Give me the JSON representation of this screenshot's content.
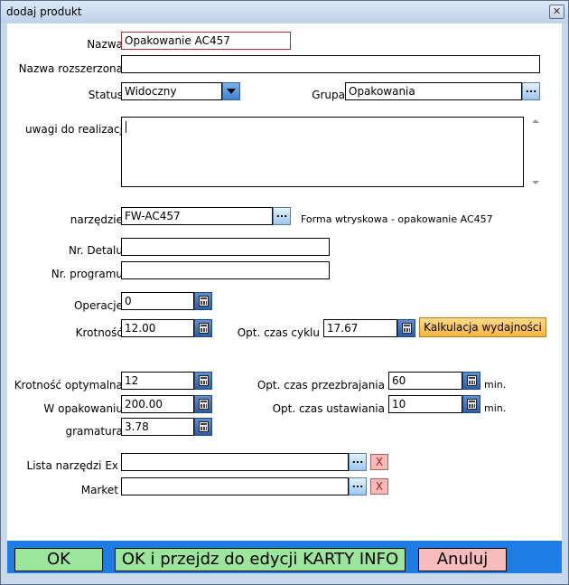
{
  "window": {
    "title": "dodaj produkt",
    "close_label": "✕"
  },
  "form": {
    "nazwa": {
      "label": "Nazwa",
      "value": "Opakowanie AC457"
    },
    "nazwa_rozszerzona": {
      "label": "Nazwa rozszerzona",
      "value": ""
    },
    "status": {
      "label": "Status",
      "value": "Widoczny"
    },
    "grupa": {
      "label": "Grupa",
      "value": "Opakowania"
    },
    "uwagi": {
      "label": "uwagi do realizacji",
      "value": ""
    },
    "narzedzie": {
      "label": "narzędzie",
      "value": "FW-AC457",
      "description": "Forma wtryskowa - opakowanie AC457"
    },
    "nr_detalu": {
      "label": "Nr. Detalu",
      "value": ""
    },
    "nr_programu": {
      "label": "Nr. programu",
      "value": ""
    },
    "operacje": {
      "label": "Operacje",
      "value": "0"
    },
    "krotnosc": {
      "label": "Krotność",
      "value": "12.00"
    },
    "opt_czas_cyklu": {
      "label": "Opt. czas cyklu",
      "value": "17.67"
    },
    "kalkulacja_label": "Kalkulacja wydajności",
    "krotnosc_optymalna": {
      "label": "Krotność optymalna",
      "value": "12"
    },
    "opt_czas_przezbrajania": {
      "label": "Opt. czas przezbrajania",
      "value": "60",
      "unit": "min."
    },
    "w_opakowaniu": {
      "label": "W opakowaniu",
      "value": "200.00"
    },
    "opt_czas_ustawiania": {
      "label": "Opt. czas ustawiania",
      "value": "10",
      "unit": "min."
    },
    "gramatura": {
      "label": "gramatura",
      "value": "3.78"
    },
    "lista_narzedzi": {
      "label": "Lista narzędzi Ex",
      "value": ""
    },
    "market": {
      "label": "Market",
      "value": ""
    },
    "dots_label": "...",
    "x_label": "X"
  },
  "footer": {
    "ok_label": "OK",
    "ok_karta_label": "OK i przejdz do edycji KARTY INFO",
    "cancel_label": "Anuluj"
  },
  "colors": {
    "footer_bg": "#1e7ce5",
    "ok_bg": "#9ce69c",
    "cancel_bg": "#f7bcbc",
    "kalk_bg": "#f6b63e"
  }
}
